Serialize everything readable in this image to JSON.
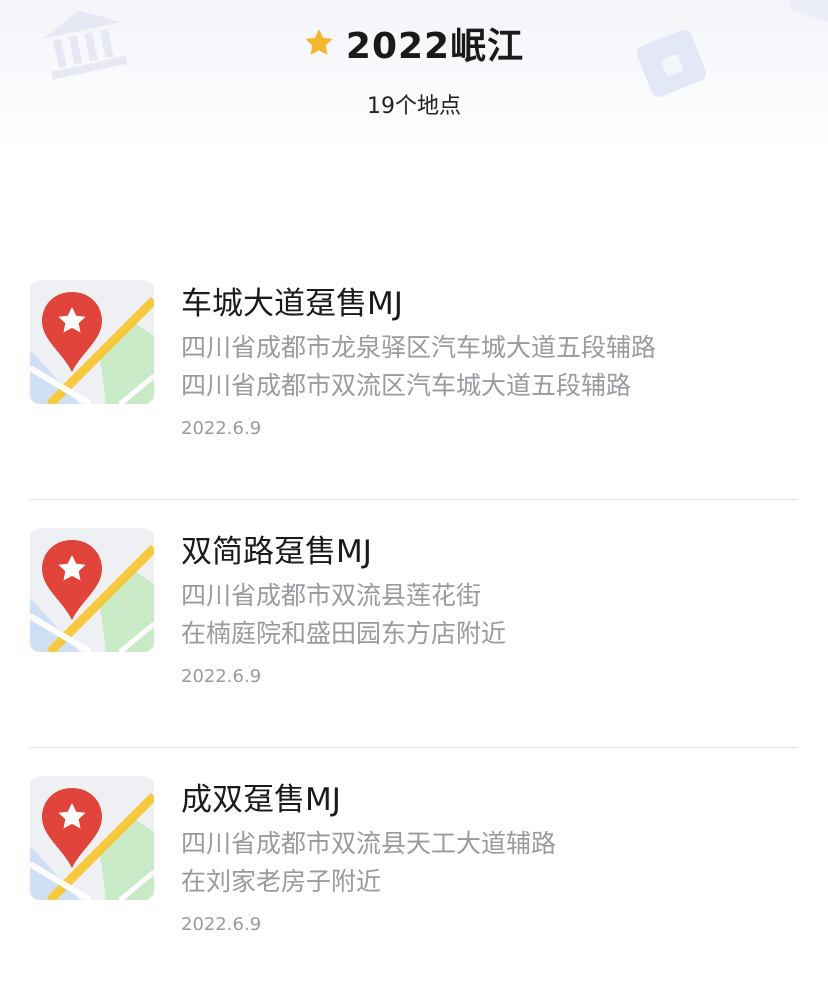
{
  "header": {
    "title": "2022岷江",
    "subtitle": "19个地点",
    "star_color": "#f5b630"
  },
  "places": [
    {
      "name": "车城大道趸售MJ",
      "address_line1": "四川省成都市龙泉驿区汽车城大道五段辅路",
      "address_line2": "四川省成都市双流区汽车城大道五段辅路",
      "date": "2022.6.9",
      "icon": "map-pin-icon"
    },
    {
      "name": "双简路趸售MJ",
      "address_line1": "四川省成都市双流县莲花街",
      "address_line2": "在楠庭院和盛田园东方店附近",
      "date": "2022.6.9",
      "icon": "map-pin-icon"
    },
    {
      "name": "成双趸售MJ",
      "address_line1": "四川省成都市双流县天工大道辅路",
      "address_line2": "在刘家老房子附近",
      "date": "2022.6.9",
      "icon": "map-pin-icon"
    }
  ],
  "colors": {
    "pin_red": "#e0443a",
    "map_road_yellow": "#f6c93f",
    "map_green": "#c9eac6",
    "map_blue": "#cfe0f5",
    "secondary_text": "#9a9aa0"
  }
}
